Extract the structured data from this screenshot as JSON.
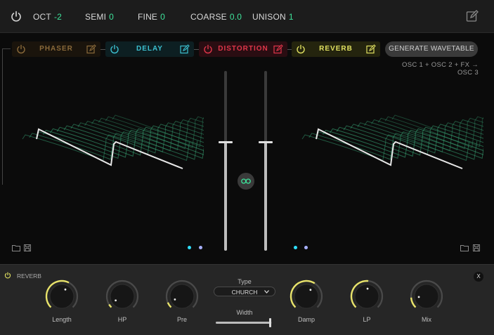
{
  "topbar": {
    "oct_label": "OCT",
    "oct_value": "-2",
    "semi_label": "SEMI",
    "semi_value": "0",
    "fine_label": "FINE",
    "fine_value": "0",
    "coarse_label": "COARSE",
    "coarse_value": "0.0",
    "unison_label": "UNISON",
    "unison_value": "1"
  },
  "fx_chain": [
    {
      "name": "PHASER",
      "color": "#8a6a3a"
    },
    {
      "name": "DELAY",
      "color": "#3cc0d0"
    },
    {
      "name": "DISTORTION",
      "color": "#e0364a"
    },
    {
      "name": "REVERB",
      "color": "#e0e060"
    }
  ],
  "generate_button": "GENERATE WAVETABLE",
  "routing_text": "OSC 1 + OSC 2 + FX → OSC 3",
  "faders": {
    "left_level": 0.6,
    "right_level": 0.6
  },
  "accent_color": "#3ee29a",
  "bottom": {
    "section_label": "REVERB",
    "type_label": "Type",
    "type_value": "CHURCH",
    "width_label": "Width",
    "width_value": 0.98,
    "close_label": "X",
    "knobs": [
      {
        "label": "Length",
        "value": 0.6
      },
      {
        "label": "HP",
        "value": 0.05
      },
      {
        "label": "Pre",
        "value": 0.08
      },
      {
        "label": "Damp",
        "value": 0.62
      },
      {
        "label": "LP",
        "value": 0.52
      },
      {
        "label": "Mix",
        "value": 0.15
      }
    ]
  }
}
